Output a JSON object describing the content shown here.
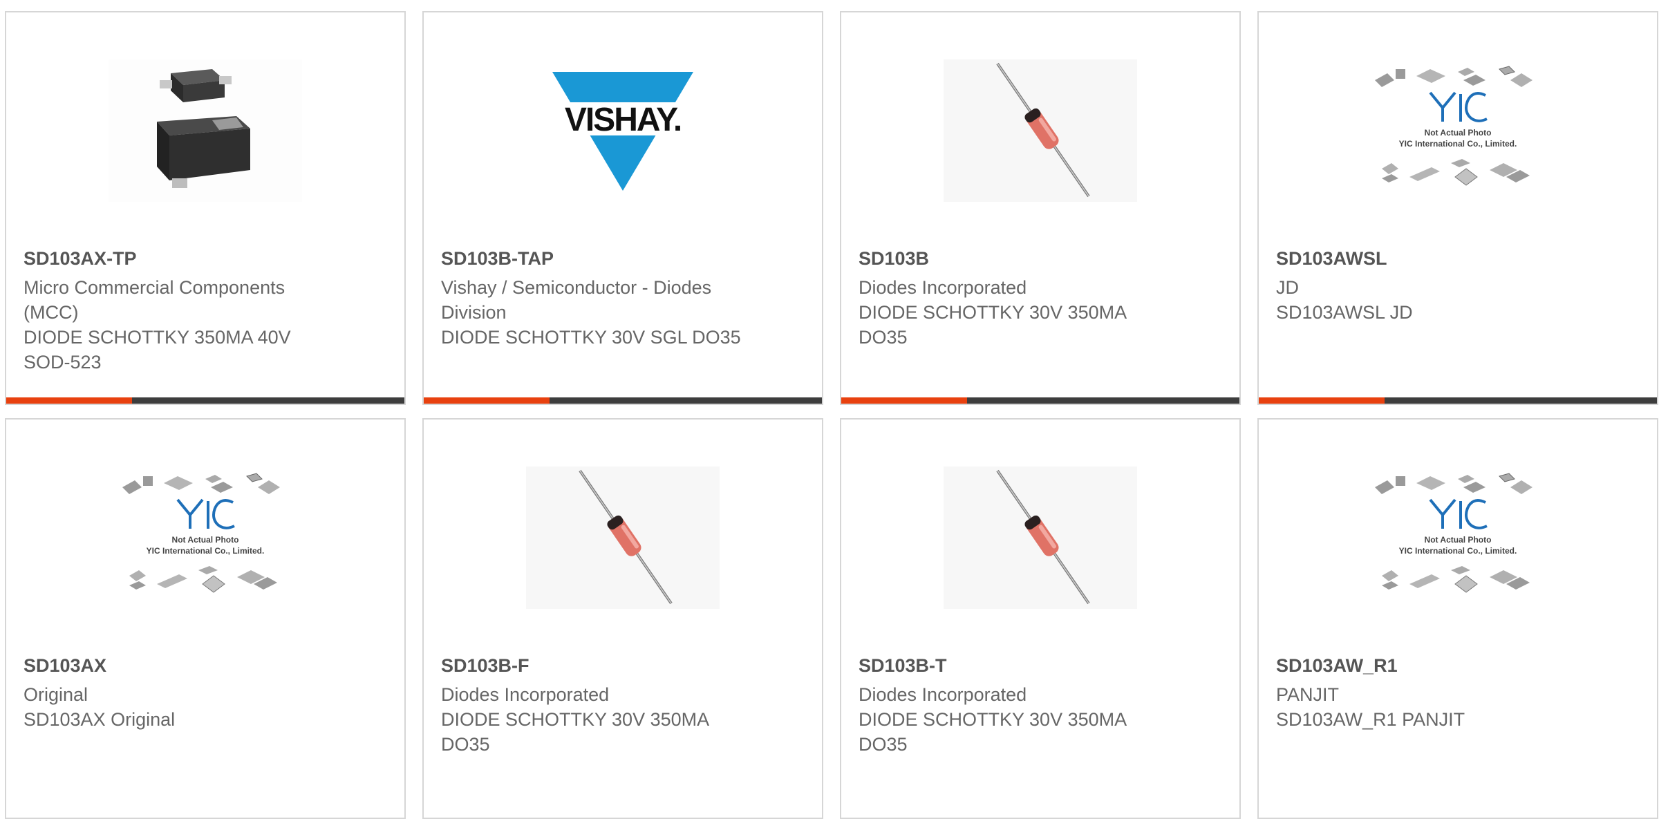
{
  "cards": [
    {
      "part": "SD103AX-TP",
      "lines": [
        "Micro Commercial Components (MCC)",
        "DIODE SCHOTTKY 350MA 40V SOD-523"
      ],
      "image": "sod523-package"
    },
    {
      "part": "SD103B-TAP",
      "lines": [
        "Vishay / Semiconductor - Diodes Division",
        "DIODE SCHOTTKY 30V SGL DO35"
      ],
      "image": "vishay-logo",
      "logo_text": "VISHAY."
    },
    {
      "part": "SD103B",
      "lines": [
        "Diodes Incorporated",
        "DIODE SCHOTTKY 30V 350MA DO35"
      ],
      "image": "do35-diode"
    },
    {
      "part": "SD103AWSL",
      "lines": [
        "JD",
        "SD103AWSL JD"
      ],
      "image": "yic-placeholder"
    },
    {
      "part": "SD103AX",
      "lines": [
        "Original",
        "SD103AX Original"
      ],
      "image": "yic-placeholder"
    },
    {
      "part": "SD103B-F",
      "lines": [
        "Diodes Incorporated",
        "DIODE SCHOTTKY 30V 350MA DO35"
      ],
      "image": "do35-diode"
    },
    {
      "part": "SD103B-T",
      "lines": [
        "Diodes Incorporated",
        "DIODE SCHOTTKY 30V 350MA DO35"
      ],
      "image": "do35-diode"
    },
    {
      "part": "SD103AW_R1",
      "lines": [
        "PANJIT",
        "SD103AW_R1 PANJIT"
      ],
      "image": "yic-placeholder"
    }
  ],
  "placeholder": {
    "logo": "YIC",
    "line1": "Not Actual Photo",
    "line2": "YIC International Co., Limited."
  },
  "colors": {
    "accent": "#e8410f",
    "bar": "#3d3d3d",
    "vishay_blue": "#1a98d5",
    "yic_blue": "#1e6fb8"
  }
}
